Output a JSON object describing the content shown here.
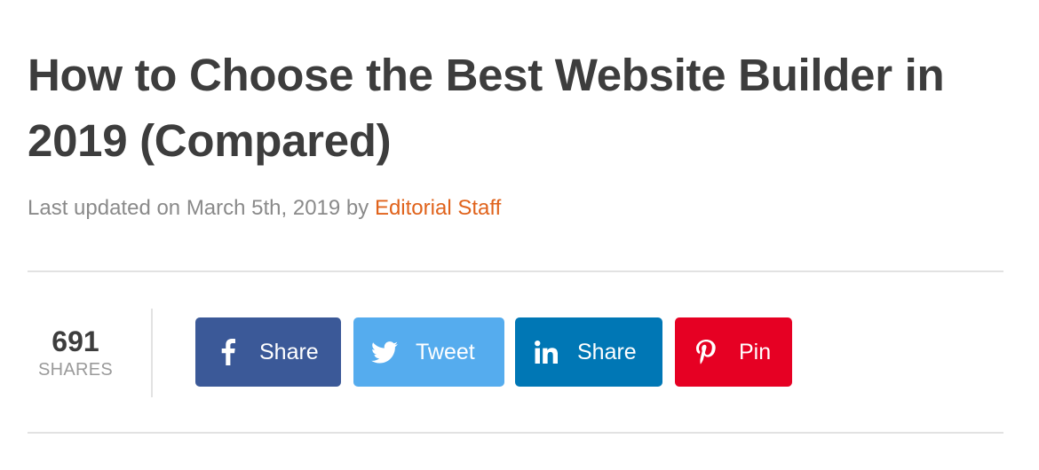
{
  "article": {
    "title": "How to Choose the Best Website Builder in 2019 (Compared)",
    "meta_prefix": "Last updated on March 5th, 2019 by ",
    "author": "Editorial Staff"
  },
  "shares": {
    "count": "691",
    "label": "SHARES"
  },
  "share_buttons": [
    {
      "network": "facebook",
      "icon": "facebook-icon",
      "label": "Share",
      "color": "#3b5998"
    },
    {
      "network": "twitter",
      "icon": "twitter-icon",
      "label": "Tweet",
      "color": "#55acee"
    },
    {
      "network": "linkedin",
      "icon": "linkedin-icon",
      "label": "Share",
      "color": "#0077b5"
    },
    {
      "network": "pinterest",
      "icon": "pinterest-icon",
      "label": "Pin",
      "color": "#e60023"
    }
  ],
  "colors": {
    "title": "#3d3d3d",
    "meta": "#8a8a8a",
    "author_link": "#e0631c",
    "divider": "#e2e2e2"
  }
}
